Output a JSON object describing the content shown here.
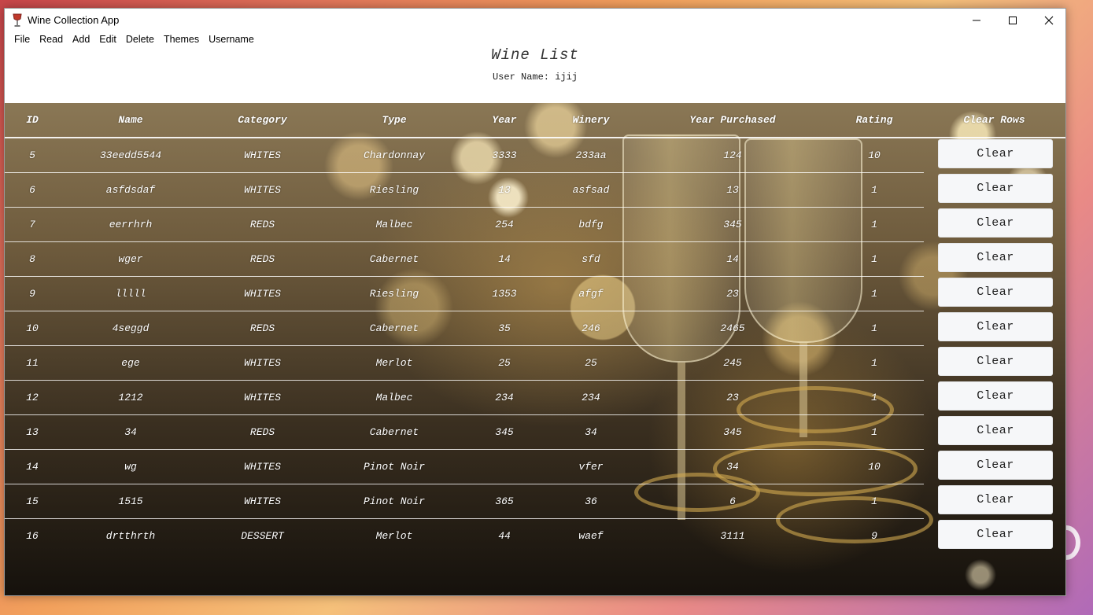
{
  "window": {
    "title": "Wine Collection App",
    "controls": {
      "minimize": "—",
      "maximize": "☐",
      "close": "✕"
    }
  },
  "menu": [
    "File",
    "Read",
    "Add",
    "Edit",
    "Delete",
    "Themes",
    "Username"
  ],
  "page": {
    "title": "Wine List",
    "user_line": "User Name: ijij"
  },
  "table": {
    "columns": [
      "ID",
      "Name",
      "Category",
      "Type",
      "Year",
      "Winery",
      "Year Purchased",
      "Rating",
      "Clear Rows"
    ],
    "rows": [
      {
        "id": "5",
        "name": "33eedd5544",
        "category": "WHITES",
        "type": "Chardonnay",
        "year": "3333",
        "winery": "233aa",
        "purchased": "124",
        "rating": "10"
      },
      {
        "id": "6",
        "name": "asfdsdaf",
        "category": "WHITES",
        "type": "Riesling",
        "year": "13",
        "winery": "asfsad",
        "purchased": "13",
        "rating": "1"
      },
      {
        "id": "7",
        "name": "eerrhrh",
        "category": "REDS",
        "type": "Malbec",
        "year": "254",
        "winery": "bdfg",
        "purchased": "345",
        "rating": "1"
      },
      {
        "id": "8",
        "name": "wger",
        "category": "REDS",
        "type": "Cabernet",
        "year": "14",
        "winery": "sfd",
        "purchased": "14",
        "rating": "1"
      },
      {
        "id": "9",
        "name": "lllll",
        "category": "WHITES",
        "type": "Riesling",
        "year": "1353",
        "winery": "afgf",
        "purchased": "23",
        "rating": "1"
      },
      {
        "id": "10",
        "name": "4seggd",
        "category": "REDS",
        "type": "Cabernet",
        "year": "35",
        "winery": "246",
        "purchased": "2465",
        "rating": "1"
      },
      {
        "id": "11",
        "name": "ege",
        "category": "WHITES",
        "type": "Merlot",
        "year": "25",
        "winery": "25",
        "purchased": "245",
        "rating": "1"
      },
      {
        "id": "12",
        "name": "1212",
        "category": "WHITES",
        "type": "Malbec",
        "year": "234",
        "winery": "234",
        "purchased": "23",
        "rating": "1"
      },
      {
        "id": "13",
        "name": "34",
        "category": "REDS",
        "type": "Cabernet",
        "year": "345",
        "winery": "34",
        "purchased": "345",
        "rating": "1"
      },
      {
        "id": "14",
        "name": "wg",
        "category": "WHITES",
        "type": "Pinot Noir",
        "year": "",
        "winery": "vfer",
        "purchased": "34",
        "rating": "10"
      },
      {
        "id": "15",
        "name": "1515",
        "category": "WHITES",
        "type": "Pinot Noir",
        "year": "365",
        "winery": "36",
        "purchased": "6",
        "rating": "1"
      },
      {
        "id": "16",
        "name": "drtthrth",
        "category": "DESSERT",
        "type": "Merlot",
        "year": "44",
        "winery": "waef",
        "purchased": "3111",
        "rating": "9"
      }
    ],
    "clear_label": "Clear"
  }
}
